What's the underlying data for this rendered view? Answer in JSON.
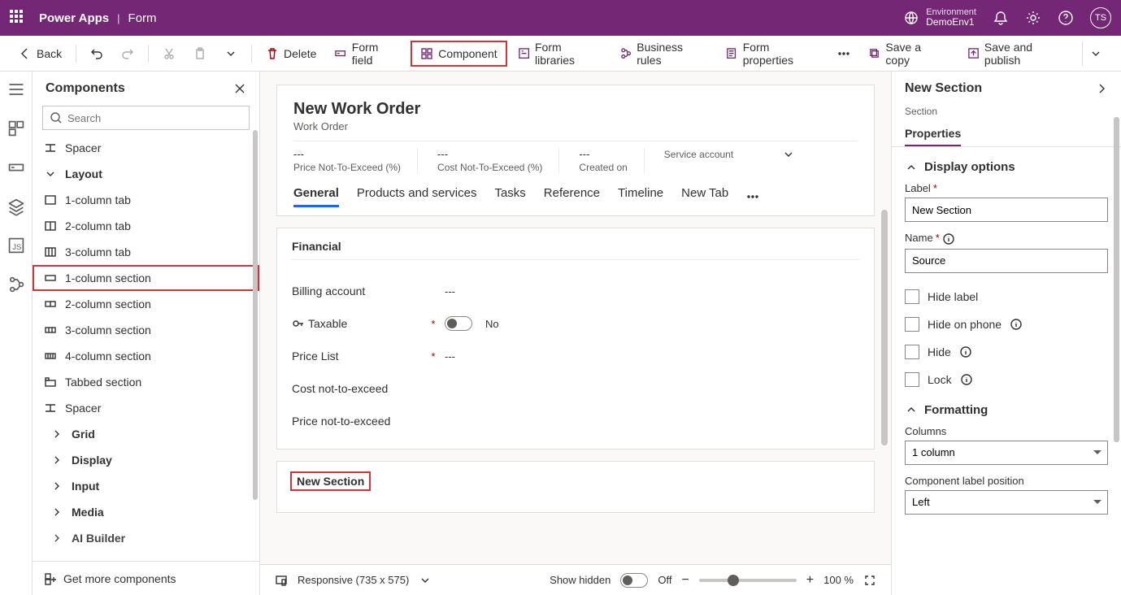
{
  "topbar": {
    "app": "Power Apps",
    "page": "Form",
    "env_label": "Environment",
    "env_name": "DemoEnv1",
    "avatar": "TS"
  },
  "cmdbar": {
    "back": "Back",
    "delete": "Delete",
    "form_field": "Form field",
    "component": "Component",
    "form_libraries": "Form libraries",
    "business_rules": "Business rules",
    "form_properties": "Form properties",
    "save_copy": "Save a copy",
    "save_publish": "Save and publish"
  },
  "left": {
    "title": "Components",
    "search_placeholder": "Search",
    "spacer": "Spacer",
    "layout": "Layout",
    "items": [
      "1-column tab",
      "2-column tab",
      "3-column tab",
      "1-column section",
      "2-column section",
      "3-column section",
      "4-column section",
      "Tabbed section",
      "Spacer"
    ],
    "groups": [
      "Grid",
      "Display",
      "Input",
      "Media",
      "AI Builder"
    ],
    "footer": "Get more components"
  },
  "form": {
    "title": "New Work Order",
    "entity": "Work Order",
    "header_fields": [
      {
        "value": "---",
        "label": "Price Not-To-Exceed (%)"
      },
      {
        "value": "---",
        "label": "Cost Not-To-Exceed (%)"
      },
      {
        "value": "---",
        "label": "Created on"
      },
      {
        "value": "",
        "label": "Service account"
      }
    ],
    "tabs": [
      "General",
      "Products and services",
      "Tasks",
      "Reference",
      "Timeline",
      "New Tab"
    ],
    "section_title": "Financial",
    "rows": {
      "billing": {
        "label": "Billing account",
        "value": "---"
      },
      "taxable": {
        "label": "Taxable",
        "value": "No"
      },
      "pricelist": {
        "label": "Price List",
        "value": "---"
      },
      "costnte": {
        "label": "Cost not-to-exceed"
      },
      "pricente": {
        "label": "Price not-to-exceed"
      }
    },
    "newsection": "New Section",
    "footer": {
      "responsive": "Responsive (735 x 575)",
      "show_hidden": "Show hidden",
      "off": "Off",
      "zoom": "100 %"
    }
  },
  "right": {
    "title": "New Section",
    "subtitle": "Section",
    "tab": "Properties",
    "display_options": "Display options",
    "label_lbl": "Label",
    "label_val": "New Section",
    "name_lbl": "Name",
    "name_val": "Source",
    "hide_label": "Hide label",
    "hide_phone": "Hide on phone",
    "hide": "Hide",
    "lock": "Lock",
    "formatting": "Formatting",
    "columns_lbl": "Columns",
    "columns_val": "1 column",
    "comp_label_pos": "Component label position",
    "comp_label_val": "Left"
  }
}
